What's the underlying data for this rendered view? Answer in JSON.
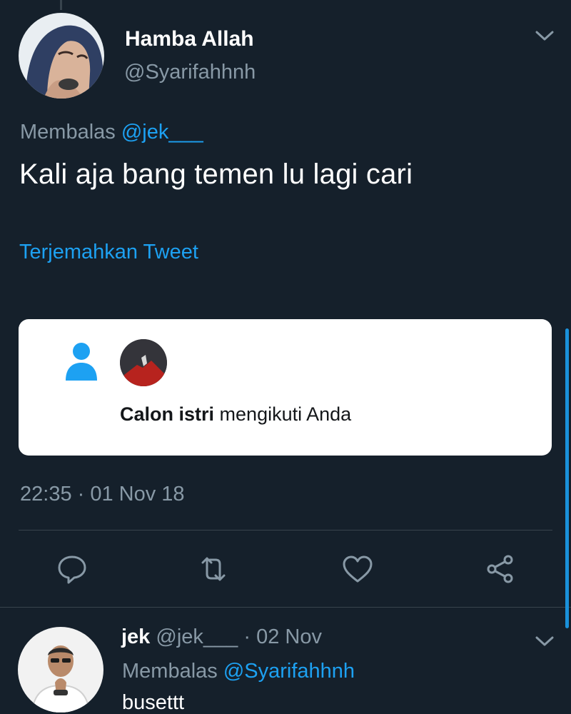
{
  "tweet": {
    "display_name": "Hamba Allah",
    "handle": "@Syarifahhnh",
    "replying_prefix": "Membalas",
    "replying_to": "@jek___",
    "text": "Kali aja bang temen lu lagi cari",
    "translate_label": "Terjemahkan Tweet",
    "timestamp": "22:35 · 01 Nov 18",
    "attached_card": {
      "bold_name": "Calon istri",
      "rest_text": "mengikuti Anda"
    }
  },
  "actions": {
    "reply_icon": "reply-icon",
    "retweet_icon": "retweet-icon",
    "like_icon": "heart-icon",
    "share_icon": "share-icon"
  },
  "reply": {
    "display_name": "jek",
    "handle": "@jek___",
    "date": "· 02 Nov",
    "replying_prefix": "Membalas",
    "replying_to": "@Syarifahhnh",
    "text": "busettt"
  },
  "colors": {
    "background": "#15202b",
    "accent": "#1da1f2",
    "secondary_text": "#8899a6"
  }
}
